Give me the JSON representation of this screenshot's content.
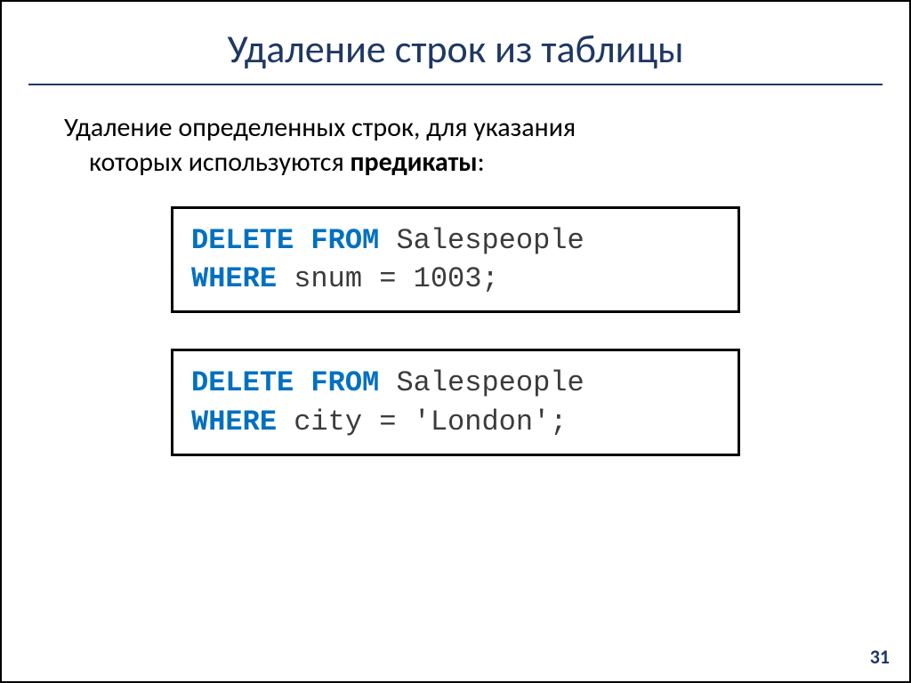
{
  "title": "Удаление строк из таблицы",
  "body": {
    "line1": "Удаление определенных строк, для указания",
    "line2_prefix": "которых используются ",
    "line2_bold": "предикаты",
    "line2_suffix": ":"
  },
  "code1": {
    "kw1": "DELETE FROM",
    "rest1": " Salespeople",
    "kw2": "WHERE",
    "rest2": " snum = 1003;"
  },
  "code2": {
    "kw1": "DELETE FROM",
    "rest1": " Salespeople",
    "kw2": "WHERE",
    "rest2": " city = 'London';"
  },
  "page_number": "31"
}
